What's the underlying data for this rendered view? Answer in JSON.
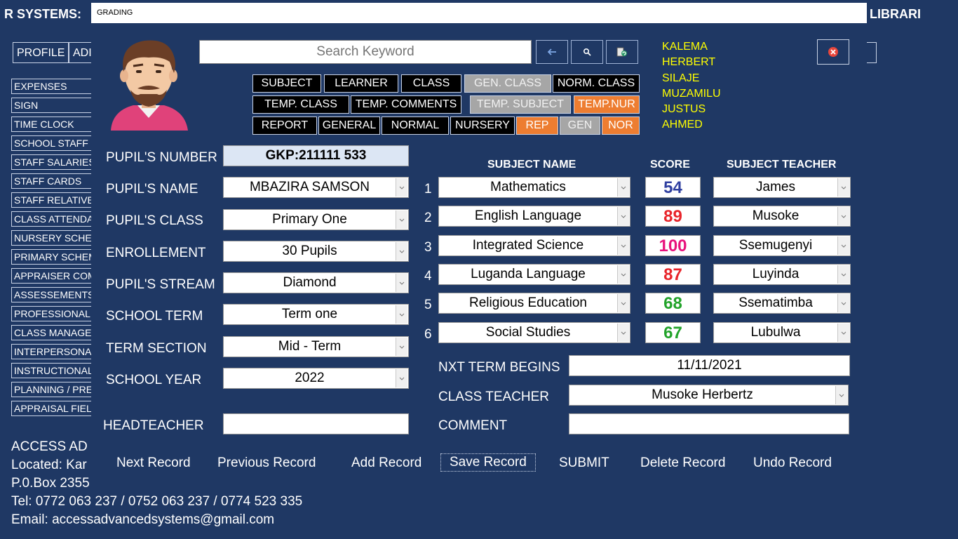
{
  "background": {
    "title_left": "R SYSTEMS:",
    "title_right": "LIBRARI",
    "top_buttons": [
      "PROFILE",
      "ADI"
    ],
    "sidebar_items": [
      "EXPENSES",
      "SIGN",
      "TIME CLOCK",
      "SCHOOL STAFF",
      "STAFF SALARIES",
      "STAFF CARDS",
      "STAFF RELATIVE",
      "CLASS ATTENDA",
      "NURSERY SCHE",
      "PRIMARY SCHEM",
      "APPRAISER COM",
      "ASSESSEMENTS",
      "PROFESSIONALI",
      "CLASS MANAGE",
      "INTERPERSONA",
      "INSTRUCTIONAL",
      "PLANNING / PRE",
      "APPRAISAL FIEL"
    ],
    "contact": {
      "company": "ACCESS AD",
      "located": "Located: Kar",
      "pobox": "P.0.Box 2355",
      "tel": "Tel: 0772 063 237 / 0752 063 237 / 0774 523 335",
      "email": "Email: accessadvancedsystems@gmail.com"
    }
  },
  "window": {
    "title": "GRADING",
    "search_placeholder": "Search Keyword",
    "names": [
      "KALEMA",
      "HERBERT",
      "SILAJE",
      "MUZAMILU",
      "JUSTUS",
      "AHMED"
    ],
    "nav_rows": [
      [
        {
          "label": "SUBJECT",
          "style": "black"
        },
        {
          "label": "LEARNER",
          "style": "black"
        },
        {
          "label": "CLASS",
          "style": "black"
        },
        {
          "label": "GEN. CLASS",
          "style": "gray"
        },
        {
          "label": "NORM. CLASS",
          "style": "black"
        }
      ],
      [
        {
          "label": "TEMP. CLASS",
          "style": "black"
        },
        {
          "label": "TEMP. COMMENTS",
          "style": "black"
        },
        {
          "label": "TEMP. SUBJECT",
          "style": "gray"
        },
        {
          "label": "TEMP.NUR",
          "style": "orange"
        }
      ],
      [
        {
          "label": "REPORT",
          "style": "black"
        },
        {
          "label": "GENERAL",
          "style": "black"
        },
        {
          "label": "NORMAL",
          "style": "black"
        },
        {
          "label": "NURSERY",
          "style": "black"
        },
        {
          "label": "REP",
          "style": "orange"
        },
        {
          "label": "GEN",
          "style": "gray"
        },
        {
          "label": "NOR",
          "style": "orange"
        }
      ]
    ],
    "form": {
      "pupil_number_label": "PUPIL'S NUMBER",
      "pupil_number": "GKP:211111 533",
      "pupil_name_label": "PUPIL'S NAME",
      "pupil_name": "MBAZIRA SAMSON",
      "pupil_class_label": "PUPIL'S CLASS",
      "pupil_class": "Primary One",
      "enrollment_label": "ENROLLEMENT",
      "enrollment": "30 Pupils",
      "stream_label": "PUPIL'S STREAM",
      "stream": "Diamond",
      "term_label": "SCHOOL TERM",
      "term": "Term one",
      "section_label": "TERM SECTION",
      "section": "Mid - Term",
      "year_label": "SCHOOL YEAR",
      "year": "2022",
      "headteacher_label": "HEADTEACHER",
      "headteacher": ""
    },
    "subjects_table": {
      "headers": {
        "subject": "SUBJECT NAME",
        "score": "SCORE",
        "teacher": "SUBJECT TEACHER"
      },
      "rows": [
        {
          "num": "1",
          "subject": "Mathematics",
          "score": "54",
          "score_color": "#2f3fa0",
          "teacher": "James"
        },
        {
          "num": "2",
          "subject": "English Language",
          "score": "89",
          "score_color": "#e8242a",
          "teacher": "Musoke"
        },
        {
          "num": "3",
          "subject": "Integrated Science",
          "score": "100",
          "score_color": "#e8127c",
          "teacher": "Ssemugenyi"
        },
        {
          "num": "4",
          "subject": "Luganda Language",
          "score": "87",
          "score_color": "#e8242a",
          "teacher": "Luyinda"
        },
        {
          "num": "5",
          "subject": "Religious Education",
          "score": "68",
          "score_color": "#22a32a",
          "teacher": "Ssematimba"
        },
        {
          "num": "6",
          "subject": "Social Studies",
          "score": "67",
          "score_color": "#22a32a",
          "teacher": "Lubulwa"
        }
      ]
    },
    "footer_fields": {
      "next_term_label": "NXT TERM BEGINS",
      "next_term": "11/11/2021",
      "class_teacher_label": "CLASS TEACHER",
      "class_teacher": "Musoke Herbertz",
      "comment_label": "COMMENT",
      "comment": ""
    },
    "actions": [
      "Next Record",
      "Previous Record",
      "Add Record",
      "Save Record",
      "SUBMIT",
      "Delete Record",
      "Undo Record"
    ],
    "colors": {
      "background": "#1f3864",
      "names": "#ffff00",
      "orange": "#ed7d31",
      "gray": "#a6a6a6"
    }
  }
}
